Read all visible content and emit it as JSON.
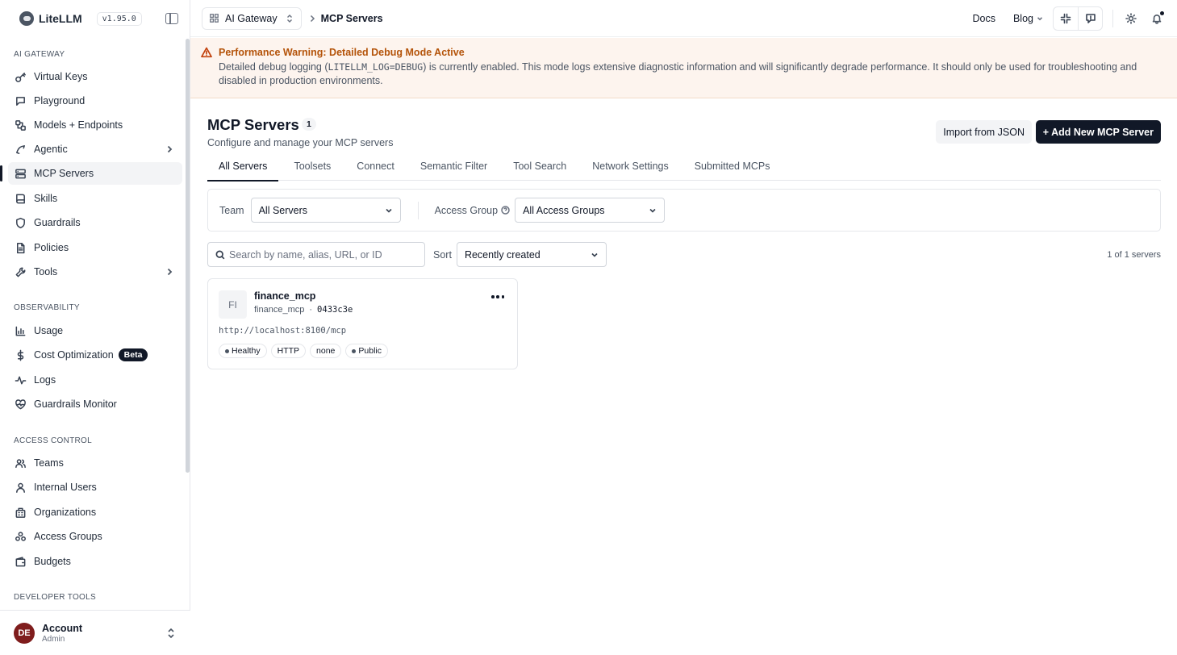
{
  "brand": {
    "name": "LiteLLM",
    "version": "v1.95.0"
  },
  "sidebar": {
    "sections": [
      {
        "title": "AI GATEWAY",
        "items": [
          {
            "label": "Virtual Keys",
            "icon": "key-icon"
          },
          {
            "label": "Playground",
            "icon": "playground-icon"
          },
          {
            "label": "Models + Endpoints",
            "icon": "models-icon"
          },
          {
            "label": "Agentic",
            "icon": "agentic-icon",
            "expandable": true
          },
          {
            "label": "MCP Servers",
            "icon": "servers-icon",
            "active": true
          },
          {
            "label": "Skills",
            "icon": "book-icon"
          },
          {
            "label": "Guardrails",
            "icon": "shield-icon"
          },
          {
            "label": "Policies",
            "icon": "document-icon"
          },
          {
            "label": "Tools",
            "icon": "wrench-icon",
            "expandable": true
          }
        ]
      },
      {
        "title": "OBSERVABILITY",
        "items": [
          {
            "label": "Usage",
            "icon": "bar-chart-icon"
          },
          {
            "label": "Cost Optimization",
            "icon": "dollar-icon",
            "badge": "Beta"
          },
          {
            "label": "Logs",
            "icon": "pulse-icon"
          },
          {
            "label": "Guardrails Monitor",
            "icon": "heart-pulse-icon"
          }
        ]
      },
      {
        "title": "ACCESS CONTROL",
        "items": [
          {
            "label": "Teams",
            "icon": "users-icon"
          },
          {
            "label": "Internal Users",
            "icon": "user-icon"
          },
          {
            "label": "Organizations",
            "icon": "building-icon"
          },
          {
            "label": "Access Groups",
            "icon": "group-icon"
          },
          {
            "label": "Budgets",
            "icon": "wallet-icon"
          }
        ]
      },
      {
        "title": "DEVELOPER TOOLS",
        "items": []
      }
    ],
    "account": {
      "initials": "DE",
      "name": "Account",
      "role": "Admin"
    }
  },
  "topbar": {
    "gateway": "AI Gateway",
    "breadcrumb": "MCP Servers",
    "docs": "Docs",
    "blog": "Blog"
  },
  "banner": {
    "title": "Performance Warning: Detailed Debug Mode Active",
    "body_prefix": "Detailed debug logging (",
    "body_code": "LITELLM_LOG=DEBUG",
    "body_suffix": ") is currently enabled. This mode logs extensive diagnostic information and will significantly degrade performance. It should only be used for troubleshooting and disabled in production environments."
  },
  "page": {
    "title": "MCP Servers",
    "count": "1",
    "subtitle": "Configure and manage your MCP servers",
    "import_label": "Import from JSON",
    "add_label": "+ Add New MCP Server"
  },
  "tabs": [
    "All Servers",
    "Toolsets",
    "Connect",
    "Semantic Filter",
    "Tool Search",
    "Network Settings",
    "Submitted MCPs"
  ],
  "filters": {
    "team_label": "Team",
    "team_value": "All Servers",
    "access_group_label": "Access Group",
    "access_group_value": "All Access Groups"
  },
  "search": {
    "placeholder": "Search by name, alias, URL, or ID",
    "sort_label": "Sort",
    "sort_value": "Recently created",
    "result_count": "1 of 1 servers"
  },
  "server_card": {
    "initials": "FI",
    "name": "finance_mcp",
    "alias": "finance_mcp",
    "separator": "·",
    "id": "0433c3e",
    "url": "http://localhost:8100/mcp",
    "tags": [
      {
        "label": "Healthy",
        "dot": true
      },
      {
        "label": "HTTP",
        "dot": false
      },
      {
        "label": "none",
        "dot": false
      },
      {
        "label": "Public",
        "dot": true
      }
    ]
  }
}
